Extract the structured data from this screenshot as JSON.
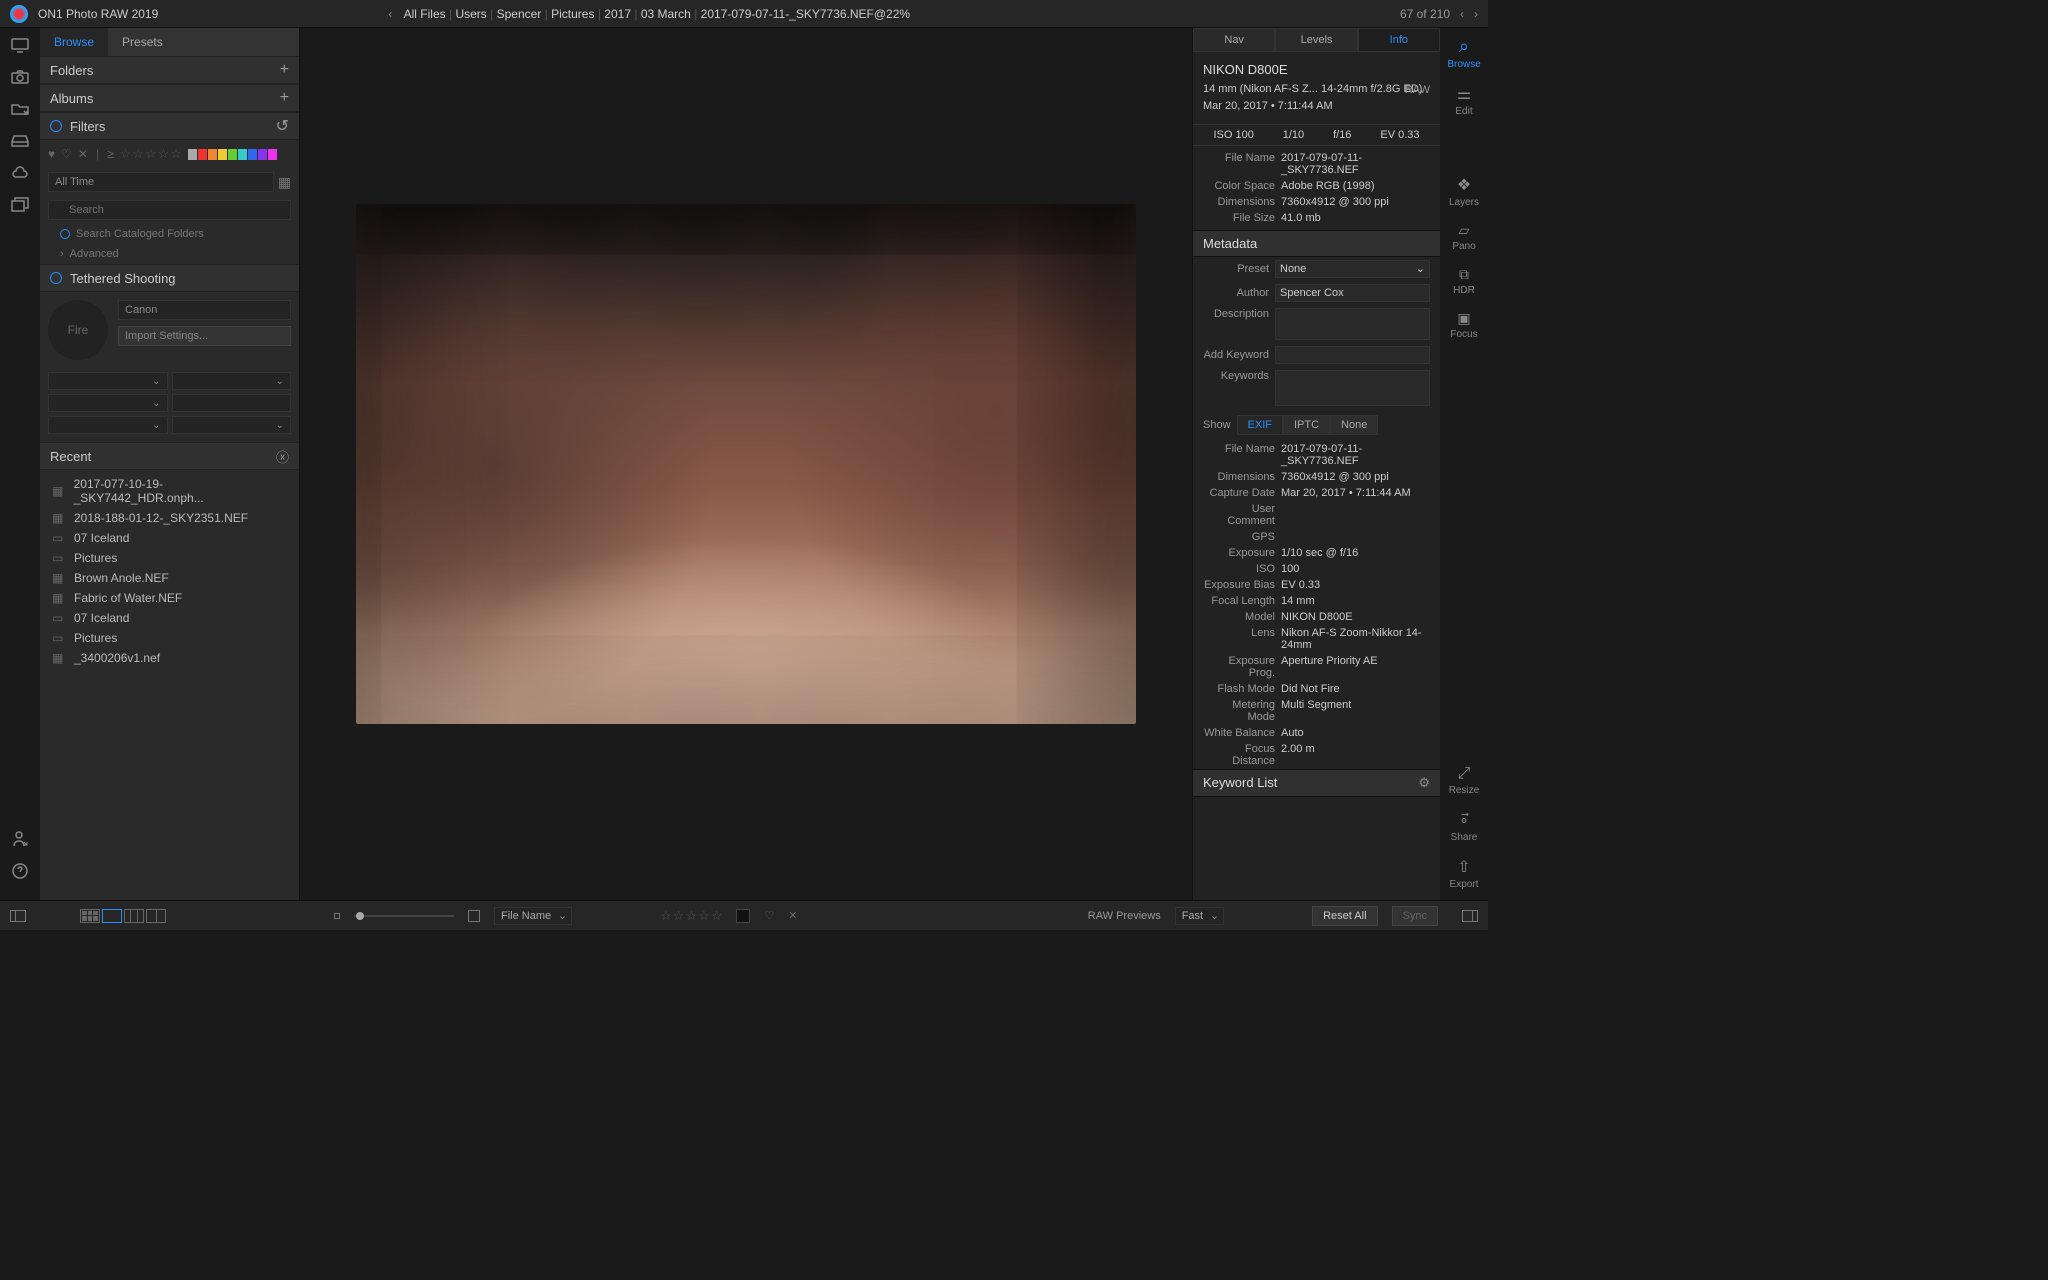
{
  "app_title": "ON1 Photo RAW 2019",
  "breadcrumbs": [
    "All Files",
    "Users",
    "Spencer",
    "Pictures",
    "2017",
    "03 March",
    "2017-079-07-11-_SKY7736.NEF@22%"
  ],
  "counter": "67 of 210",
  "left_tabs": {
    "browse": "Browse",
    "presets": "Presets"
  },
  "sections": {
    "folders": "Folders",
    "albums": "Albums",
    "filters": "Filters",
    "tethered": "Tethered Shooting",
    "recent": "Recent"
  },
  "filters": {
    "alltime": "All Time",
    "search_placeholder": "Search",
    "cataloged": "Search Cataloged Folders",
    "advanced": "Advanced"
  },
  "tether": {
    "fire": "Fire",
    "vendor": "Canon",
    "import": "Import Settings..."
  },
  "recent": [
    {
      "icon": "img",
      "name": "2017-077-10-19-_SKY7442_HDR.onph..."
    },
    {
      "icon": "img",
      "name": "2018-188-01-12-_SKY2351.NEF"
    },
    {
      "icon": "folder",
      "name": "07 Iceland"
    },
    {
      "icon": "folder",
      "name": "Pictures"
    },
    {
      "icon": "img",
      "name": "Brown Anole.NEF"
    },
    {
      "icon": "img",
      "name": "Fabric of Water.NEF"
    },
    {
      "icon": "folder",
      "name": "07 Iceland"
    },
    {
      "icon": "folder",
      "name": "Pictures"
    },
    {
      "icon": "img",
      "name": "_3400206v1.nef"
    }
  ],
  "right_tabs": {
    "nav": "Nav",
    "levels": "Levels",
    "info": "Info"
  },
  "right_tools": {
    "browse": "Browse",
    "edit": "Edit",
    "layers": "Layers",
    "pano": "Pano",
    "hdr": "HDR",
    "focus": "Focus",
    "resize": "Resize",
    "share": "Share",
    "export": "Export"
  },
  "info": {
    "camera": "NIKON D800E",
    "lens": "14 mm (Nikon AF-S Z... 14-24mm f/2.8G ED)",
    "datetime": "Mar 20, 2017 • 7:11:44 AM",
    "badge": "RAW",
    "iso": "ISO 100",
    "shutter": "1/10",
    "aperture": "f/16",
    "ev": "EV 0.33",
    "top_kv": [
      {
        "k": "File Name",
        "v": "2017-079-07-11-_SKY7736.NEF"
      },
      {
        "k": "Color Space",
        "v": "Adobe RGB (1998)"
      },
      {
        "k": "Dimensions",
        "v": "7360x4912 @ 300 ppi"
      },
      {
        "k": "File Size",
        "v": "41.0 mb"
      }
    ]
  },
  "metadata": {
    "title": "Metadata",
    "preset_label": "Preset",
    "preset_value": "None",
    "author_label": "Author",
    "author_value": "Spencer Cox",
    "description_label": "Description",
    "add_keyword_label": "Add Keyword",
    "keywords_label": "Keywords",
    "show": "Show",
    "exif": "EXIF",
    "iptc": "IPTC",
    "none": "None",
    "kv": [
      {
        "k": "File Name",
        "v": "2017-079-07-11-_SKY7736.NEF"
      },
      {
        "k": "Dimensions",
        "v": "7360x4912 @ 300 ppi"
      },
      {
        "k": "Capture Date",
        "v": "Mar 20, 2017 • 7:11:44 AM"
      },
      {
        "k": "User Comment",
        "v": ""
      },
      {
        "k": "GPS",
        "v": ""
      },
      {
        "k": "Exposure",
        "v": "1/10 sec @ f/16"
      },
      {
        "k": "ISO",
        "v": "100"
      },
      {
        "k": "Exposure Bias",
        "v": "EV 0.33"
      },
      {
        "k": "Focal Length",
        "v": "14 mm"
      },
      {
        "k": "Model",
        "v": "NIKON D800E"
      },
      {
        "k": "Lens",
        "v": "Nikon AF-S Zoom-Nikkor 14-24mm"
      },
      {
        "k": "Exposure Prog.",
        "v": "Aperture Priority AE"
      },
      {
        "k": "Flash Mode",
        "v": "Did Not Fire"
      },
      {
        "k": "Metering Mode",
        "v": "Multi Segment"
      },
      {
        "k": "White Balance",
        "v": "Auto"
      },
      {
        "k": "Focus Distance",
        "v": "2.00 m"
      }
    ]
  },
  "keyword_list": "Keyword List",
  "bottom": {
    "sort_label": "File Name",
    "raw_previews": "RAW Previews",
    "fast": "Fast",
    "reset": "Reset All",
    "sync": "Sync"
  },
  "swatches": [
    "#aaa",
    "#e33",
    "#e83",
    "#ec3",
    "#6c3",
    "#3cc",
    "#36e",
    "#83e",
    "#e3e"
  ]
}
